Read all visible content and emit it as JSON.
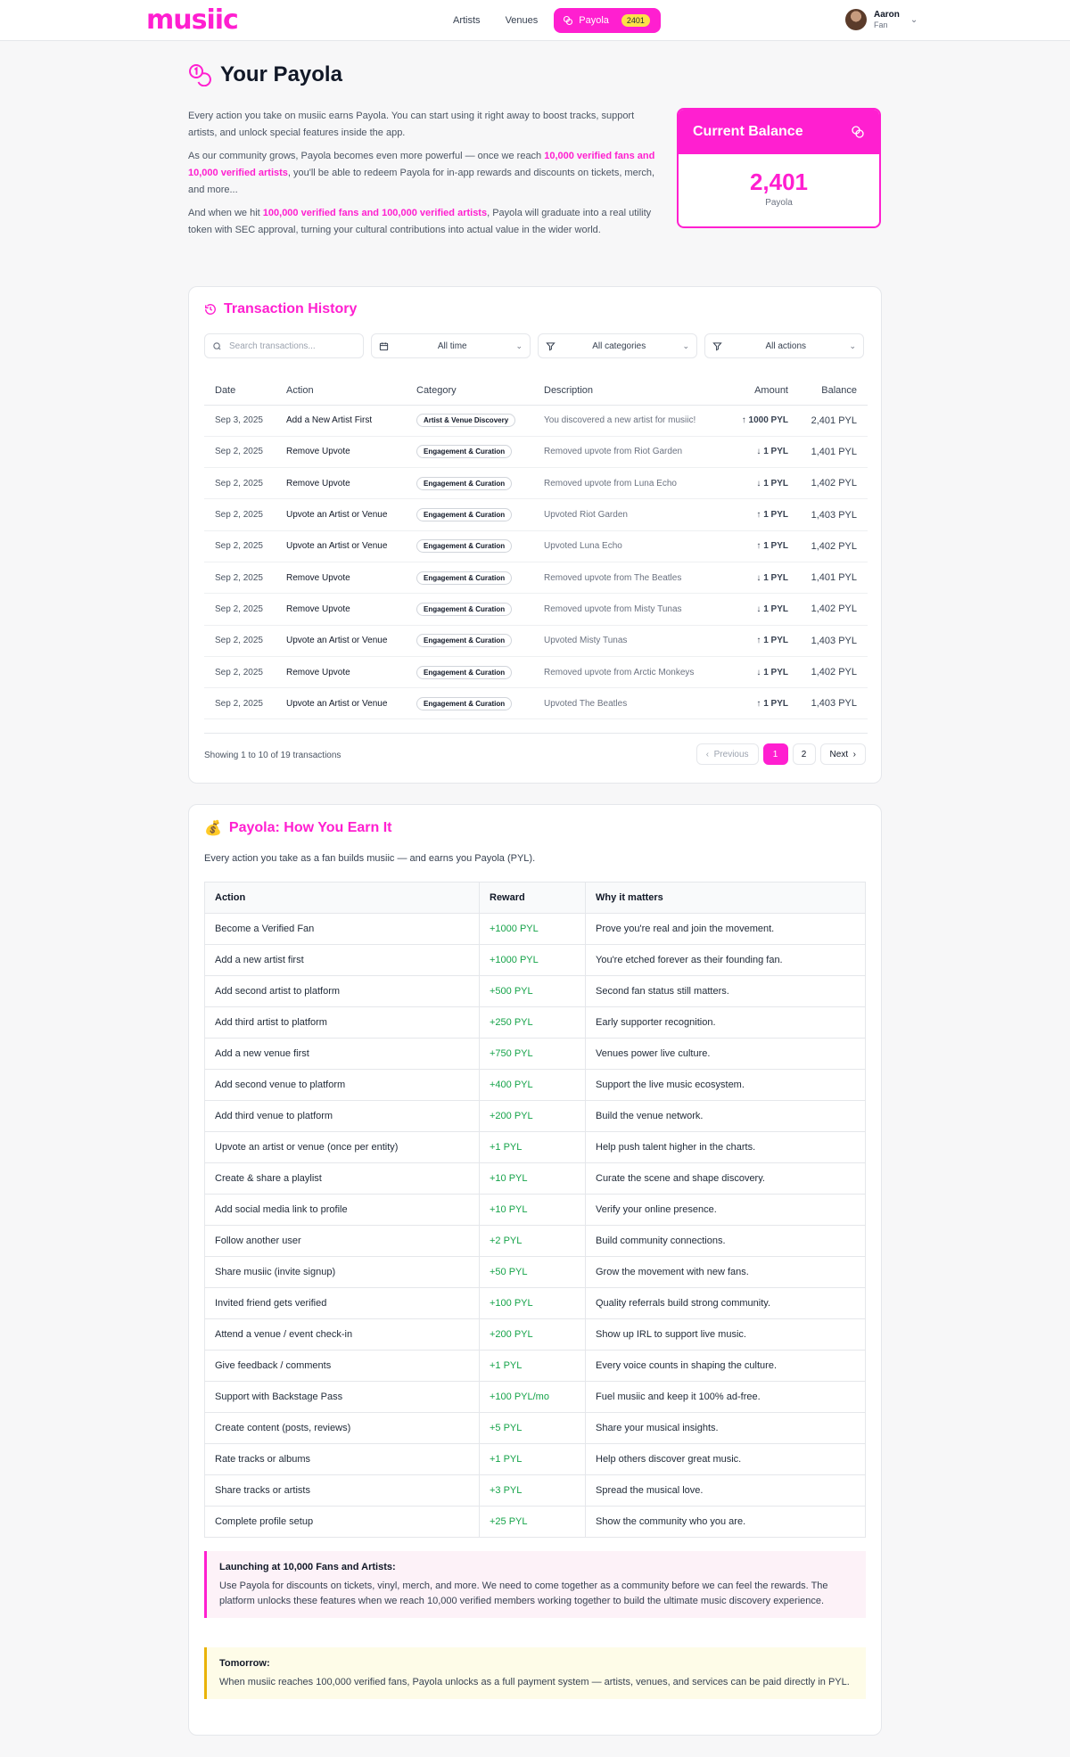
{
  "header": {
    "logo": "musiic",
    "nav": {
      "artists": "Artists",
      "venues": "Venues",
      "payola": "Payola",
      "payola_badge": "2401"
    },
    "user": {
      "name": "Aaron",
      "role": "Fan"
    }
  },
  "page": {
    "title": "Your Payola",
    "intro": {
      "p1": "Every action you take on musiic earns Payola. You can start using it right away to boost tracks, support artists, and unlock special features inside the app.",
      "p2_a": "As our community grows, Payola becomes even more powerful — once we reach ",
      "p2_hl": "10,000 verified fans and 10,000 verified artists",
      "p2_b": ", you'll be able to redeem Payola for in-app rewards and discounts on tickets, merch, and more...",
      "p3_a": "And when we hit ",
      "p3_hl": "100,000 verified fans and 100,000 verified artists",
      "p3_b": ", Payola will graduate into a real utility token with SEC approval, turning your cultural contributions into actual value in the wider world."
    },
    "balance": {
      "title": "Current Balance",
      "value": "2,401",
      "unit": "Payola"
    }
  },
  "transactions": {
    "title": "Transaction History",
    "search_placeholder": "Search transactions...",
    "filters": {
      "time": "All time",
      "categories": "All categories",
      "actions": "All actions"
    },
    "columns": [
      "Date",
      "Action",
      "Category",
      "Description",
      "Amount",
      "Balance"
    ],
    "rows": [
      {
        "date": "Sep 3, 2025",
        "action": "Add a New Artist First",
        "category": "Artist & Venue Discovery",
        "description": "You discovered a new artist for musiic!",
        "amount": "1000 PYL",
        "direction": "up",
        "balance": "2,401 PYL"
      },
      {
        "date": "Sep 2, 2025",
        "action": "Remove Upvote",
        "category": "Engagement & Curation",
        "description": "Removed upvote from Riot Garden",
        "amount": "1 PYL",
        "direction": "down",
        "balance": "1,401 PYL"
      },
      {
        "date": "Sep 2, 2025",
        "action": "Remove Upvote",
        "category": "Engagement & Curation",
        "description": "Removed upvote from Luna Echo",
        "amount": "1 PYL",
        "direction": "down",
        "balance": "1,402 PYL"
      },
      {
        "date": "Sep 2, 2025",
        "action": "Upvote an Artist or Venue",
        "category": "Engagement & Curation",
        "description": "Upvoted Riot Garden",
        "amount": "1 PYL",
        "direction": "up",
        "balance": "1,403 PYL"
      },
      {
        "date": "Sep 2, 2025",
        "action": "Upvote an Artist or Venue",
        "category": "Engagement & Curation",
        "description": "Upvoted Luna Echo",
        "amount": "1 PYL",
        "direction": "up",
        "balance": "1,402 PYL"
      },
      {
        "date": "Sep 2, 2025",
        "action": "Remove Upvote",
        "category": "Engagement & Curation",
        "description": "Removed upvote from The Beatles",
        "amount": "1 PYL",
        "direction": "down",
        "balance": "1,401 PYL"
      },
      {
        "date": "Sep 2, 2025",
        "action": "Remove Upvote",
        "category": "Engagement & Curation",
        "description": "Removed upvote from Misty Tunas",
        "amount": "1 PYL",
        "direction": "down",
        "balance": "1,402 PYL"
      },
      {
        "date": "Sep 2, 2025",
        "action": "Upvote an Artist or Venue",
        "category": "Engagement & Curation",
        "description": "Upvoted Misty Tunas",
        "amount": "1 PYL",
        "direction": "up",
        "balance": "1,403 PYL"
      },
      {
        "date": "Sep 2, 2025",
        "action": "Remove Upvote",
        "category": "Engagement & Curation",
        "description": "Removed upvote from Arctic Monkeys",
        "amount": "1 PYL",
        "direction": "down",
        "balance": "1,402 PYL"
      },
      {
        "date": "Sep 2, 2025",
        "action": "Upvote an Artist or Venue",
        "category": "Engagement & Curation",
        "description": "Upvoted The Beatles",
        "amount": "1 PYL",
        "direction": "up",
        "balance": "1,403 PYL"
      }
    ],
    "showing": "Showing 1 to 10 of 19 transactions",
    "pagination": {
      "previous": "Previous",
      "pages": [
        "1",
        "2"
      ],
      "next": "Next"
    }
  },
  "earn": {
    "icon": "💰",
    "title": "Payola: How You Earn It",
    "subtitle": "Every action you take as a fan builds musiic — and earns you Payola (PYL).",
    "columns": [
      "Action",
      "Reward",
      "Why it matters"
    ],
    "rows": [
      [
        "Become a Verified Fan",
        "+1000 PYL",
        "Prove you're real and join the movement."
      ],
      [
        "Add a new artist first",
        "+1000 PYL",
        "You're etched forever as their founding fan."
      ],
      [
        "Add second artist to platform",
        "+500 PYL",
        "Second fan status still matters."
      ],
      [
        "Add third artist to platform",
        "+250 PYL",
        "Early supporter recognition."
      ],
      [
        "Add a new venue first",
        "+750 PYL",
        "Venues power live culture."
      ],
      [
        "Add second venue to platform",
        "+400 PYL",
        "Support the live music ecosystem."
      ],
      [
        "Add third venue to platform",
        "+200 PYL",
        "Build the venue network."
      ],
      [
        "Upvote an artist or venue (once per entity)",
        "+1 PYL",
        "Help push talent higher in the charts."
      ],
      [
        "Create & share a playlist",
        "+10 PYL",
        "Curate the scene and shape discovery."
      ],
      [
        "Add social media link to profile",
        "+10 PYL",
        "Verify your online presence."
      ],
      [
        "Follow another user",
        "+2 PYL",
        "Build community connections."
      ],
      [
        "Share musiic (invite signup)",
        "+50 PYL",
        "Grow the movement with new fans."
      ],
      [
        "Invited friend gets verified",
        "+100 PYL",
        "Quality referrals build strong community."
      ],
      [
        "Attend a venue / event check-in",
        "+200 PYL",
        "Show up IRL to support live music."
      ],
      [
        "Give feedback / comments",
        "+1 PYL",
        "Every voice counts in shaping the culture."
      ],
      [
        "Support with Backstage Pass",
        "+100 PYL/mo",
        "Fuel musiic and keep it 100% ad-free."
      ],
      [
        "Create content (posts, reviews)",
        "+5 PYL",
        "Share your musical insights."
      ],
      [
        "Rate tracks or albums",
        "+1 PYL",
        "Help others discover great music."
      ],
      [
        "Share tracks or artists",
        "+3 PYL",
        "Spread the musical love."
      ],
      [
        "Complete profile setup",
        "+25 PYL",
        "Show the community who you are."
      ]
    ],
    "notes": [
      {
        "title": "Launching at 10,000 Fans and Artists:",
        "body": "Use Payola for discounts on tickets, vinyl, merch, and more. We need to come together as a community before we can feel the rewards. The platform unlocks these features when we reach 10,000 verified members working together to build the ultimate music discovery experience."
      },
      {
        "title": "Tomorrow:",
        "body": "When musiic reaches 100,000 verified fans, Payola unlocks as a full payment system — artists, venues, and services can be paid directly in PYL."
      }
    ]
  },
  "colors": {
    "brand": "#ff1fd0",
    "up": "#16a34a",
    "down": "#dc2626",
    "badge": "#fde047"
  }
}
